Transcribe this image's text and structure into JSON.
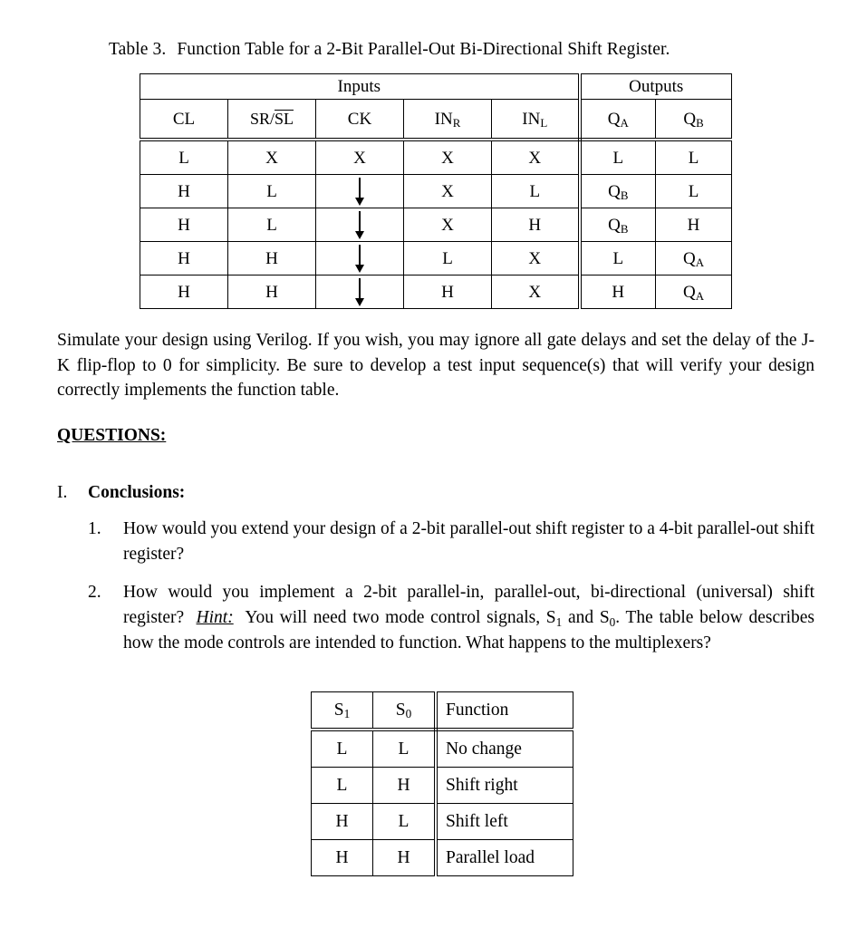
{
  "document": {
    "table3": {
      "caption_prefix": "Table 3.",
      "caption_text": "Function Table for a 2-Bit Parallel-Out Bi-Directional Shift Register.",
      "group_headers": {
        "inputs": "Inputs",
        "outputs": "Outputs"
      },
      "columns": [
        {
          "key": "cl",
          "label": "CL",
          "group": "inputs"
        },
        {
          "key": "srsl",
          "label": "SR/SL",
          "label_plain": "SR",
          "label_overlined": "SL",
          "group": "inputs"
        },
        {
          "key": "ck",
          "label": "CK",
          "group": "inputs"
        },
        {
          "key": "inr",
          "label": "IN",
          "sub": "R",
          "group": "inputs"
        },
        {
          "key": "inl",
          "label": "IN",
          "sub": "L",
          "group": "inputs"
        },
        {
          "key": "qa",
          "label": "Q",
          "sub": "A",
          "group": "outputs"
        },
        {
          "key": "qb",
          "label": "Q",
          "sub": "B",
          "group": "outputs"
        }
      ],
      "rows": [
        {
          "cl": "L",
          "srsl": "X",
          "ck": "X",
          "inr": "X",
          "inl": "X",
          "qa": "L",
          "qa_sub": "",
          "qb": "L",
          "qb_sub": ""
        },
        {
          "cl": "H",
          "srsl": "L",
          "ck": "arrow-down",
          "inr": "X",
          "inl": "L",
          "qa": "Q",
          "qa_sub": "B",
          "qb": "L",
          "qb_sub": ""
        },
        {
          "cl": "H",
          "srsl": "L",
          "ck": "arrow-down",
          "inr": "X",
          "inl": "H",
          "qa": "Q",
          "qa_sub": "B",
          "qb": "H",
          "qb_sub": ""
        },
        {
          "cl": "H",
          "srsl": "H",
          "ck": "arrow-down",
          "inr": "L",
          "inl": "X",
          "qa": "L",
          "qa_sub": "",
          "qb": "Q",
          "qb_sub": "A"
        },
        {
          "cl": "H",
          "srsl": "H",
          "ck": "arrow-down",
          "inr": "H",
          "inl": "X",
          "qa": "H",
          "qa_sub": "",
          "qb": "Q",
          "qb_sub": "A"
        }
      ]
    },
    "paragraph": "Simulate your design using Verilog.  If you wish, you may ignore all gate delays and set the delay of the J-K flip-flop to 0 for simplicity.  Be sure to develop a test input sequence(s) that will verify your design correctly implements the function table.",
    "questions_heading": "QUESTIONS:",
    "section": {
      "numeral": "I.",
      "label": "Conclusions:"
    },
    "question_items": [
      {
        "marker": "1.",
        "text": "How would you extend your design of a 2-bit parallel-out shift register to a 4-bit parallel-out shift register?"
      },
      {
        "marker": "2.",
        "part1": "How would you implement a 2-bit parallel-in, parallel-out, bi-directional (universal) shift register?",
        "hint_label": "Hint:",
        "part2": "You will need two mode control signals, S",
        "sub1": "1",
        "part3": " and S",
        "sub0": "0",
        "part4": ".  The table below describes how the mode controls are intended to function. What happens to the multiplexers?"
      }
    ],
    "mode_table": {
      "headers": [
        {
          "label": "S",
          "sub": "1"
        },
        {
          "label": "S",
          "sub": "0"
        },
        {
          "label": "Function",
          "sub": ""
        }
      ],
      "rows": [
        {
          "s1": "L",
          "s0": "L",
          "function": "No change"
        },
        {
          "s1": "L",
          "s0": "H",
          "function": "Shift right"
        },
        {
          "s1": "H",
          "s0": "L",
          "function": "Shift left"
        },
        {
          "s1": "H",
          "s0": "H",
          "function": "Parallel load"
        }
      ]
    }
  }
}
